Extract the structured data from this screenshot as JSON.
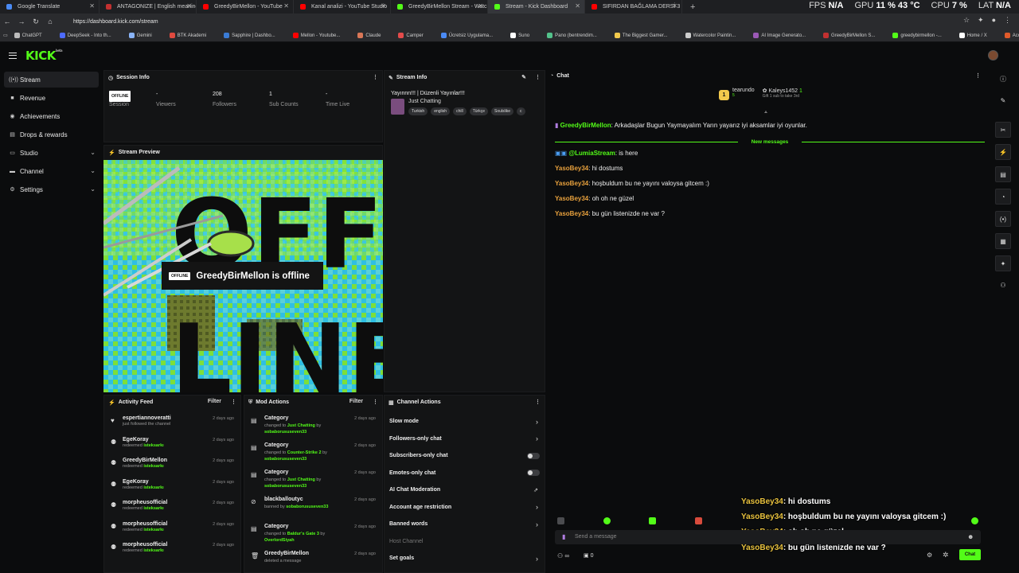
{
  "browser": {
    "tabs": [
      {
        "label": "Google Translate",
        "color": "#4a8af4",
        "active": false
      },
      {
        "label": "ANTAGONIZE | English meaning -",
        "color": "#c23030",
        "active": false
      },
      {
        "label": "GreedyBirMellon - YouTube",
        "color": "#ff0000",
        "active": false
      },
      {
        "label": "Kanal analizi - YouTube Studio",
        "color": "#ff0000",
        "active": false
      },
      {
        "label": "GreedyBirMellon Stream - Watch",
        "color": "#53fc18",
        "active": false
      },
      {
        "label": "Stream - Kick Dashboard",
        "color": "#53fc18",
        "active": true
      },
      {
        "label": "SIFIRDAN BAĞLAMA DERSİ 3 (EN",
        "color": "#ff0000",
        "active": false
      }
    ],
    "hud": [
      {
        "k": "FPS",
        "v": "N/A"
      },
      {
        "k": "GPU",
        "v": "11 % 43 °C"
      },
      {
        "k": "CPU",
        "v": "7 %"
      },
      {
        "k": "LAT",
        "v": "N/A"
      }
    ],
    "url": "https://dashboard.kick.com/stream",
    "bookmarks": [
      {
        "label": "ChatGPT",
        "color": "#bbbbbb"
      },
      {
        "label": "DeepSeek - Into th...",
        "color": "#4d6bfe"
      },
      {
        "label": "Gemini",
        "color": "#8ab4f8"
      },
      {
        "label": "BTK Akademi",
        "color": "#e04a3f"
      },
      {
        "label": "Sapphire | Dashbo...",
        "color": "#3a7bd5"
      },
      {
        "label": "Mellon - Youtube...",
        "color": "#ff0000"
      },
      {
        "label": "Claude",
        "color": "#d97757"
      },
      {
        "label": "Camper",
        "color": "#e34b4b"
      },
      {
        "label": "Ücretsiz Uygulama...",
        "color": "#4a8af4"
      },
      {
        "label": "Suno",
        "color": "#ffffff"
      },
      {
        "label": "Pano (bentrendim...",
        "color": "#53c28b"
      },
      {
        "label": "The Biggest Gamer...",
        "color": "#f2c94c"
      },
      {
        "label": "Watercolor Paintin...",
        "color": "#cccccc"
      },
      {
        "label": "AI Image Generato...",
        "color": "#9b59b6"
      },
      {
        "label": "GreedyBirMellon S...",
        "color": "#c23030"
      },
      {
        "label": "greedybirmellon -...",
        "color": "#53fc18"
      },
      {
        "label": "Home / X",
        "color": "#ffffff"
      },
      {
        "label": "Account home | Ba...",
        "color": "#e05a2a"
      }
    ]
  },
  "brand": {
    "logo": "KICK",
    "logo_sup": "beta",
    "accent": "#53fc18"
  },
  "sidebar": {
    "items": [
      {
        "label": "Stream",
        "icon": "broadcast-icon",
        "glyph": "((•))",
        "active": true,
        "chevron": false
      },
      {
        "label": "Revenue",
        "icon": "revenue-icon",
        "glyph": "■",
        "active": false,
        "chevron": false
      },
      {
        "label": "Achievements",
        "icon": "trophy-icon",
        "glyph": "◉",
        "active": false,
        "chevron": false
      },
      {
        "label": "Drops & rewards",
        "icon": "gift-icon",
        "glyph": "▤",
        "active": false,
        "chevron": false
      },
      {
        "label": "Studio",
        "icon": "studio-icon",
        "glyph": "▭",
        "active": false,
        "chevron": true
      },
      {
        "label": "Channel",
        "icon": "channel-icon",
        "glyph": "▬",
        "active": false,
        "chevron": true
      },
      {
        "label": "Settings",
        "icon": "gear-icon",
        "glyph": "⚙",
        "active": false,
        "chevron": true
      }
    ]
  },
  "session": {
    "title": "Session Info",
    "status_badge": "OFFLINE",
    "status_label": "Session",
    "stats": [
      {
        "value": "-",
        "label": "Viewers"
      },
      {
        "value": "208",
        "label": "Followers"
      },
      {
        "value": "1",
        "label": "Sub Counts"
      },
      {
        "value": "-",
        "label": "Time Live"
      }
    ]
  },
  "stream_info": {
    "title": "Stream Info",
    "stream_title": "Yayınnn!!! | Düzenli Yayınlar!!!",
    "category": "Just Chatting",
    "tags": [
      "Turkish",
      "english",
      "chill",
      "Türkçe",
      "Soulslike",
      "c"
    ]
  },
  "preview": {
    "title": "Stream Preview",
    "badge": "OFFLINE",
    "message": "GreedyBirMellon is offline",
    "art_text_1": "OFF",
    "art_text_2": "LINE"
  },
  "activity": {
    "title": "Activity Feed",
    "filter": "Filter",
    "items": [
      {
        "name": "espertiannoveratti",
        "desc": "just followed the channel",
        "highlight": "",
        "time": "2 days ago",
        "icon": "heart-icon",
        "glyph": "♥"
      },
      {
        "name": "EgeKoray",
        "desc": "redeemed",
        "highlight": "isteksarkı",
        "time": "2 days ago",
        "icon": "redeem-icon",
        "glyph": "⚉"
      },
      {
        "name": "GreedyBirMellon",
        "desc": "redeemed",
        "highlight": "isteksarkı",
        "time": "2 days ago",
        "icon": "redeem-icon",
        "glyph": "⚉"
      },
      {
        "name": "EgeKoray",
        "desc": "redeemed",
        "highlight": "isteksarkı",
        "time": "2 days ago",
        "icon": "redeem-icon",
        "glyph": "⚉"
      },
      {
        "name": "morpheusofficial",
        "desc": "redeemed",
        "highlight": "isteksarkı",
        "time": "2 days ago",
        "icon": "redeem-icon",
        "glyph": "⚉"
      },
      {
        "name": "morpheusofficial",
        "desc": "redeemed",
        "highlight": "isteksarkı",
        "time": "2 days ago",
        "icon": "redeem-icon",
        "glyph": "⚉"
      },
      {
        "name": "morpheusofficial",
        "desc": "redeemed",
        "highlight": "isteksarkı",
        "time": "2 days ago",
        "icon": "redeem-icon",
        "glyph": "⚉"
      }
    ]
  },
  "mod_actions": {
    "title": "Mod Actions",
    "filter": "Filter",
    "items": [
      {
        "name": "Category",
        "pre": "changed to",
        "hl1": "Just Chatting",
        "mid": "by",
        "hl2": "sobaborususeven33",
        "time": "2 days ago",
        "icon": "category-icon",
        "glyph": "▤"
      },
      {
        "name": "Category",
        "pre": "changed to",
        "hl1": "Counter-Strike 2",
        "mid": "by",
        "hl2": "sobaborususeven33",
        "time": "2 days ago",
        "icon": "category-icon",
        "glyph": "▤"
      },
      {
        "name": "Category",
        "pre": "changed to",
        "hl1": "Just Chatting",
        "mid": "by",
        "hl2": "sobaborususeven33",
        "time": "2 days ago",
        "icon": "category-icon",
        "glyph": "▤"
      },
      {
        "name": "blackballoutyc",
        "pre": "banned by",
        "hl1": "sobaborususeven33",
        "mid": "",
        "hl2": "",
        "time": "2 days ago",
        "icon": "ban-icon",
        "glyph": "⊘"
      },
      {
        "name": "Category",
        "pre": "changed to",
        "hl1": "Baldur's Gate 3",
        "mid": "by",
        "hl2": "OverlordSiyah",
        "time": "2 days ago",
        "icon": "category-icon",
        "glyph": "▤"
      },
      {
        "name": "GreedyBirMellon",
        "pre": "deleted a message",
        "hl1": "",
        "mid": "",
        "hl2": "",
        "time": "2 days ago",
        "icon": "trash-icon",
        "glyph": "🗑"
      },
      {
        "name": "Message Unpinned",
        "pre": "",
        "hl1": "",
        "mid": "",
        "hl2": "",
        "time": "",
        "icon": "pin-icon",
        "glyph": "▤"
      }
    ]
  },
  "channel_actions": {
    "title": "Channel Actions",
    "items": [
      {
        "label": "Slow mode",
        "control": "arrow",
        "enabled": true
      },
      {
        "label": "Followers-only chat",
        "control": "arrow",
        "enabled": true
      },
      {
        "label": "Subscribers-only chat",
        "control": "toggle",
        "enabled": true
      },
      {
        "label": "Emotes-only chat",
        "control": "toggle",
        "enabled": true
      },
      {
        "label": "AI Chat Moderation",
        "control": "external",
        "enabled": true
      },
      {
        "label": "Account age restriction",
        "control": "arrow",
        "enabled": true
      },
      {
        "label": "Banned words",
        "control": "arrow",
        "enabled": true
      },
      {
        "label": "Host Channel",
        "control": "none",
        "enabled": false
      },
      {
        "label": "Set goals",
        "control": "arrow",
        "enabled": true
      }
    ]
  },
  "chat": {
    "title": "Chat",
    "pinned": {
      "rank": "1",
      "user1": "tearundo",
      "sub1": "5",
      "user2": "Kaleys1452",
      "count2": "1",
      "gift_text": "Gift 1 sub to take 3rd"
    },
    "system_msg": {
      "user": "GreedyBirMellon",
      "text": "Arkadaşlar Bugun Yaymayalım Yarın yayarız iyi aksamlar iyi oyunlar."
    },
    "new_messages": "New messages",
    "messages": [
      {
        "user": "@LumiaStream",
        "text": "is here",
        "user_color": "#53fc18"
      },
      {
        "user": "YasoBey34",
        "text": "hi dostums",
        "user_color": "#e8a13d"
      },
      {
        "user": "YasoBey34",
        "text": "hoşbuldum bu ne yayını valoysa gitcem :)",
        "user_color": "#e8a13d"
      },
      {
        "user": "YasoBey34",
        "text": "oh oh ne güzel",
        "user_color": "#e8a13d"
      },
      {
        "user": "YasoBey34",
        "text": "bu gün listenizde ne var ?",
        "user_color": "#e8a13d"
      }
    ],
    "overlay_messages": [
      {
        "user": "YasoBey34",
        "text": ": hi dostums"
      },
      {
        "user": "YasoBey34",
        "text": ": hoşbuldum bu ne yayını valoysa gitcem :)"
      },
      {
        "user": "YasoBey34",
        "text": ": oh oh ne güzel"
      },
      {
        "user": "YasoBey34",
        "text": ": bu gün listenizde ne var ?"
      }
    ],
    "placeholder": "Send a message",
    "points": "0",
    "send_label": "Chat"
  }
}
